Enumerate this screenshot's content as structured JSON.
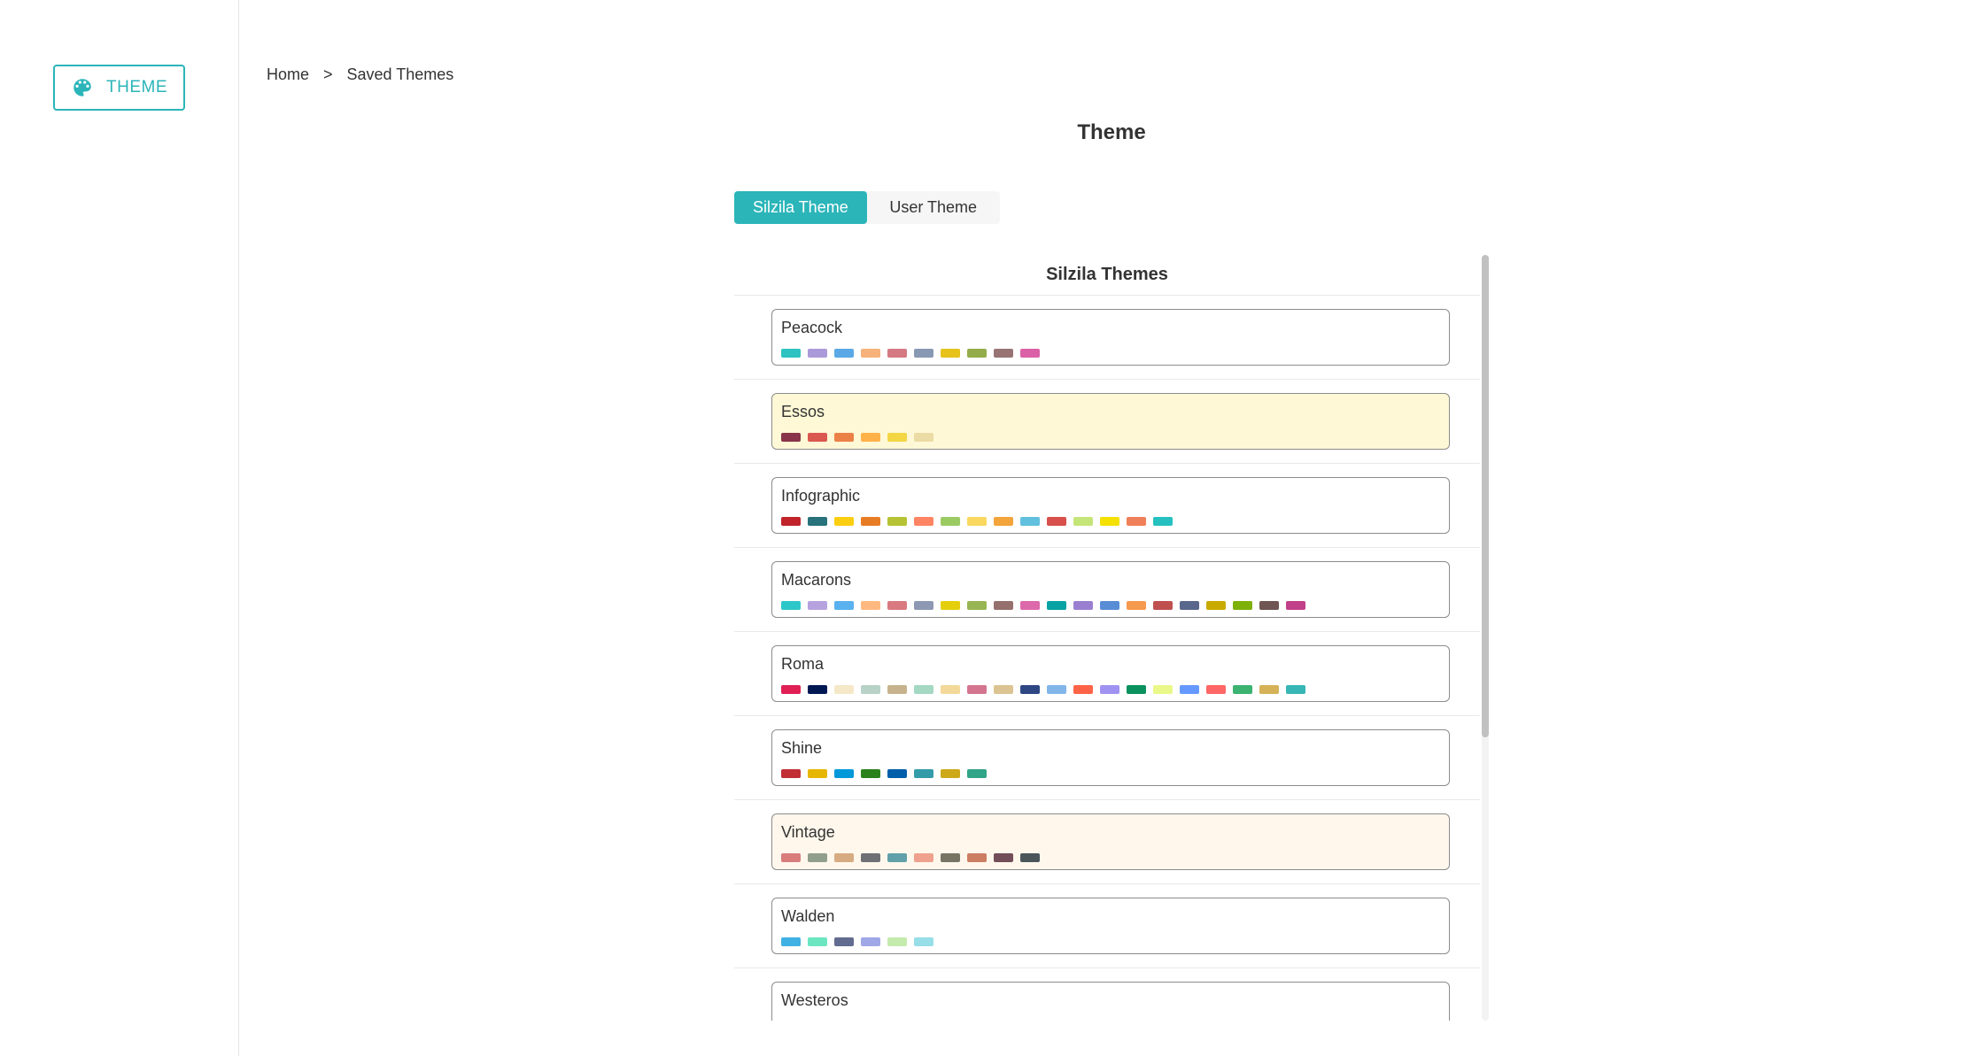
{
  "sidebar": {
    "theme_button_label": "THEME"
  },
  "breadcrumb": {
    "home": "Home",
    "separator": ">",
    "current": "Saved Themes"
  },
  "page": {
    "title": "Theme"
  },
  "tabs": [
    {
      "label": "Silzila Theme",
      "active": true
    },
    {
      "label": "User Theme",
      "active": false
    }
  ],
  "panel": {
    "title": "Silzila Themes",
    "themes": [
      {
        "name": "Peacock",
        "state": "normal",
        "colors": [
          "#2ec3c0",
          "#ab9ad9",
          "#5aa9e6",
          "#f6b27a",
          "#d57a82",
          "#8899b4",
          "#e6c21a",
          "#94ad4a",
          "#987373",
          "#db61a6"
        ]
      },
      {
        "name": "Essos",
        "state": "selected",
        "colors": [
          "#893448",
          "#d95850",
          "#eb8146",
          "#ffb248",
          "#f2d643",
          "#ebdba4"
        ]
      },
      {
        "name": "Infographic",
        "state": "normal",
        "colors": [
          "#c1232b",
          "#27727b",
          "#fcce10",
          "#e87c25",
          "#b5c334",
          "#fe8463",
          "#9bca63",
          "#fad860",
          "#f3a43b",
          "#60c0dd",
          "#d7504b",
          "#c6e579",
          "#f4e001",
          "#f0805a",
          "#26c0c0"
        ]
      },
      {
        "name": "Macarons",
        "state": "normal",
        "colors": [
          "#2ec7c9",
          "#b6a2de",
          "#5ab1ef",
          "#ffb980",
          "#d87a80",
          "#8d98b3",
          "#e5cf0d",
          "#97b552",
          "#95706d",
          "#dc69aa",
          "#07a2a4",
          "#9a7fd1",
          "#588dd5",
          "#f5994e",
          "#c05050",
          "#59678c",
          "#c9ab00",
          "#7eb00a",
          "#6f5553",
          "#c14089"
        ]
      },
      {
        "name": "Roma",
        "state": "normal",
        "colors": [
          "#e01f54",
          "#001852",
          "#f5e8c8",
          "#b8d2c7",
          "#c6b38e",
          "#a4d8c2",
          "#f3d999",
          "#d3758f",
          "#dcc392",
          "#2e4783",
          "#82b6e9",
          "#ff6347",
          "#a092f1",
          "#0a915d",
          "#eaf889",
          "#6699ff",
          "#ff6666",
          "#3cb371",
          "#d5b158",
          "#38b6b6"
        ]
      },
      {
        "name": "Shine",
        "state": "normal",
        "colors": [
          "#c12e34",
          "#e6b600",
          "#0098d9",
          "#2b821d",
          "#005eaa",
          "#339ca8",
          "#cda819",
          "#32a487"
        ]
      },
      {
        "name": "Vintage",
        "state": "highlight",
        "colors": [
          "#d87c7c",
          "#919e8b",
          "#d7ab82",
          "#6e7074",
          "#61a0a8",
          "#efa18d",
          "#787464",
          "#cc7e63",
          "#724e58",
          "#4b565b"
        ]
      },
      {
        "name": "Walden",
        "state": "normal",
        "colors": [
          "#3fb1e3",
          "#6be6c1",
          "#626c91",
          "#a0a7e6",
          "#c4ebad",
          "#96dee8"
        ]
      },
      {
        "name": "Westeros",
        "state": "normal",
        "colors": [
          "#516b91",
          "#59c4e6",
          "#edafda",
          "#93b7e3",
          "#a5e7f0",
          "#cbb0e3"
        ]
      }
    ]
  },
  "colors": {
    "accent": "#2bb5b9"
  }
}
